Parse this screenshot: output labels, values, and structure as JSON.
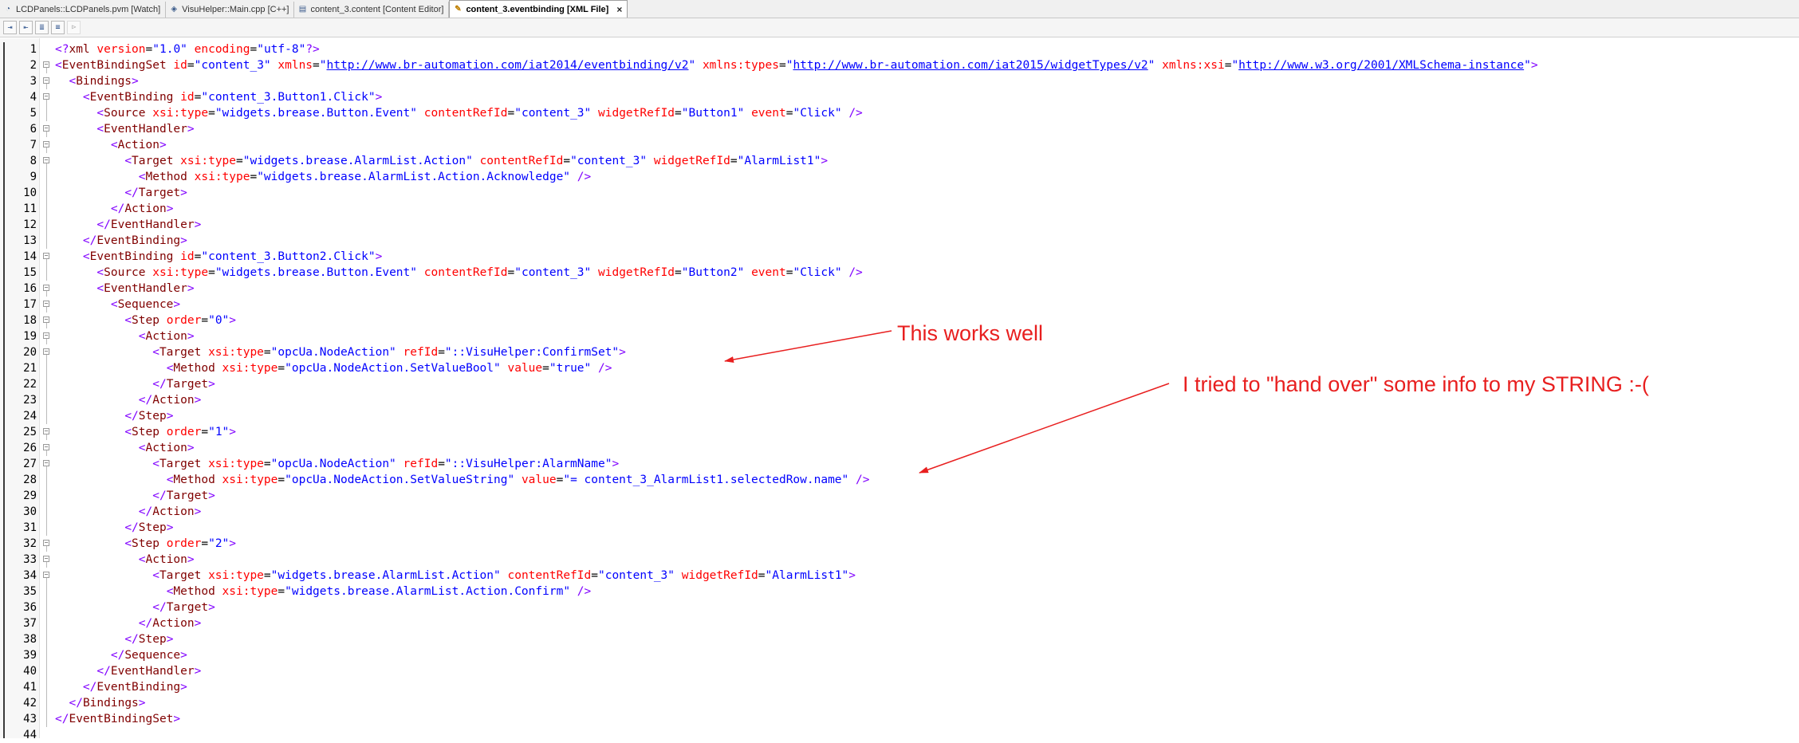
{
  "tabs": [
    {
      "label": "LCDPanels::LCDPanels.pvm [Watch]",
      "icon": "watch-icon",
      "active": false
    },
    {
      "label": "VisuHelper::Main.cpp [C++]",
      "icon": "cpp-file-icon",
      "active": false
    },
    {
      "label": "content_3.content [Content Editor]",
      "icon": "content-file-icon",
      "active": false
    },
    {
      "label": "content_3.eventbinding [XML File]",
      "icon": "xml-file-icon",
      "active": true
    }
  ],
  "active_tab_close": "×",
  "toolbar": [
    {
      "name": "toolbar-button-1",
      "glyph": "⇥"
    },
    {
      "name": "toolbar-button-2",
      "glyph": "⇤"
    },
    {
      "name": "toolbar-button-3",
      "glyph": "≣"
    },
    {
      "name": "toolbar-button-4",
      "glyph": "≡"
    },
    {
      "name": "toolbar-button-5",
      "glyph": "⊳"
    }
  ],
  "colors": {
    "annotation": "#e81f1f",
    "tag": "#800000",
    "attribute": "#ff0000",
    "value": "#0000ff",
    "bracket": "#8000ff"
  },
  "code_lines": [
    [
      [
        "b",
        "<?"
      ],
      [
        "t",
        "xml"
      ],
      [
        "n",
        " "
      ],
      [
        "a",
        "version"
      ],
      [
        "n",
        "="
      ],
      [
        "v",
        "\"1.0\""
      ],
      [
        "n",
        " "
      ],
      [
        "a",
        "encoding"
      ],
      [
        "n",
        "="
      ],
      [
        "v",
        "\"utf-8\""
      ],
      [
        "b",
        "?>"
      ]
    ],
    [
      [
        "b",
        "<"
      ],
      [
        "t",
        "EventBindingSet"
      ],
      [
        "n",
        " "
      ],
      [
        "a",
        "id"
      ],
      [
        "n",
        "="
      ],
      [
        "v",
        "\"content_3\""
      ],
      [
        "n",
        " "
      ],
      [
        "a",
        "xmlns"
      ],
      [
        "n",
        "="
      ],
      [
        "v",
        "\""
      ],
      [
        "l",
        "http://www.br-automation.com/iat2014/eventbinding/v2"
      ],
      [
        "v",
        "\""
      ],
      [
        "n",
        " "
      ],
      [
        "a",
        "xmlns:types"
      ],
      [
        "n",
        "="
      ],
      [
        "v",
        "\""
      ],
      [
        "l",
        "http://www.br-automation.com/iat2015/widgetTypes/v2"
      ],
      [
        "v",
        "\""
      ],
      [
        "n",
        " "
      ],
      [
        "a",
        "xmlns:xsi"
      ],
      [
        "n",
        "="
      ],
      [
        "v",
        "\""
      ],
      [
        "l",
        "http://www.w3.org/2001/XMLSchema-instance"
      ],
      [
        "v",
        "\""
      ],
      [
        "b",
        ">"
      ]
    ],
    [
      [
        "n",
        "  "
      ],
      [
        "b",
        "<"
      ],
      [
        "t",
        "Bindings"
      ],
      [
        "b",
        ">"
      ]
    ],
    [
      [
        "n",
        "    "
      ],
      [
        "b",
        "<"
      ],
      [
        "t",
        "EventBinding"
      ],
      [
        "n",
        " "
      ],
      [
        "a",
        "id"
      ],
      [
        "n",
        "="
      ],
      [
        "v",
        "\"content_3.Button1.Click\""
      ],
      [
        "b",
        ">"
      ]
    ],
    [
      [
        "n",
        "      "
      ],
      [
        "b",
        "<"
      ],
      [
        "t",
        "Source"
      ],
      [
        "n",
        " "
      ],
      [
        "a",
        "xsi:type"
      ],
      [
        "n",
        "="
      ],
      [
        "v",
        "\"widgets.brease.Button.Event\""
      ],
      [
        "n",
        " "
      ],
      [
        "a",
        "contentRefId"
      ],
      [
        "n",
        "="
      ],
      [
        "v",
        "\"content_3\""
      ],
      [
        "n",
        " "
      ],
      [
        "a",
        "widgetRefId"
      ],
      [
        "n",
        "="
      ],
      [
        "v",
        "\"Button1\""
      ],
      [
        "n",
        " "
      ],
      [
        "a",
        "event"
      ],
      [
        "n",
        "="
      ],
      [
        "v",
        "\"Click\""
      ],
      [
        "n",
        " "
      ],
      [
        "b",
        "/>"
      ]
    ],
    [
      [
        "n",
        "      "
      ],
      [
        "b",
        "<"
      ],
      [
        "t",
        "EventHandler"
      ],
      [
        "b",
        ">"
      ]
    ],
    [
      [
        "n",
        "        "
      ],
      [
        "b",
        "<"
      ],
      [
        "t",
        "Action"
      ],
      [
        "b",
        ">"
      ]
    ],
    [
      [
        "n",
        "          "
      ],
      [
        "b",
        "<"
      ],
      [
        "t",
        "Target"
      ],
      [
        "n",
        " "
      ],
      [
        "a",
        "xsi:type"
      ],
      [
        "n",
        "="
      ],
      [
        "v",
        "\"widgets.brease.AlarmList.Action\""
      ],
      [
        "n",
        " "
      ],
      [
        "a",
        "contentRefId"
      ],
      [
        "n",
        "="
      ],
      [
        "v",
        "\"content_3\""
      ],
      [
        "n",
        " "
      ],
      [
        "a",
        "widgetRefId"
      ],
      [
        "n",
        "="
      ],
      [
        "v",
        "\"AlarmList1\""
      ],
      [
        "b",
        ">"
      ]
    ],
    [
      [
        "n",
        "            "
      ],
      [
        "b",
        "<"
      ],
      [
        "t",
        "Method"
      ],
      [
        "n",
        " "
      ],
      [
        "a",
        "xsi:type"
      ],
      [
        "n",
        "="
      ],
      [
        "v",
        "\"widgets.brease.AlarmList.Action.Acknowledge\""
      ],
      [
        "n",
        " "
      ],
      [
        "b",
        "/>"
      ]
    ],
    [
      [
        "n",
        "          "
      ],
      [
        "b",
        "</"
      ],
      [
        "t",
        "Target"
      ],
      [
        "b",
        ">"
      ]
    ],
    [
      [
        "n",
        "        "
      ],
      [
        "b",
        "</"
      ],
      [
        "t",
        "Action"
      ],
      [
        "b",
        ">"
      ]
    ],
    [
      [
        "n",
        "      "
      ],
      [
        "b",
        "</"
      ],
      [
        "t",
        "EventHandler"
      ],
      [
        "b",
        ">"
      ]
    ],
    [
      [
        "n",
        "    "
      ],
      [
        "b",
        "</"
      ],
      [
        "t",
        "EventBinding"
      ],
      [
        "b",
        ">"
      ]
    ],
    [
      [
        "n",
        "    "
      ],
      [
        "b",
        "<"
      ],
      [
        "t",
        "EventBinding"
      ],
      [
        "n",
        " "
      ],
      [
        "a",
        "id"
      ],
      [
        "n",
        "="
      ],
      [
        "v",
        "\"content_3.Button2.Click\""
      ],
      [
        "b",
        ">"
      ]
    ],
    [
      [
        "n",
        "      "
      ],
      [
        "b",
        "<"
      ],
      [
        "t",
        "Source"
      ],
      [
        "n",
        " "
      ],
      [
        "a",
        "xsi:type"
      ],
      [
        "n",
        "="
      ],
      [
        "v",
        "\"widgets.brease.Button.Event\""
      ],
      [
        "n",
        " "
      ],
      [
        "a",
        "contentRefId"
      ],
      [
        "n",
        "="
      ],
      [
        "v",
        "\"content_3\""
      ],
      [
        "n",
        " "
      ],
      [
        "a",
        "widgetRefId"
      ],
      [
        "n",
        "="
      ],
      [
        "v",
        "\"Button2\""
      ],
      [
        "n",
        " "
      ],
      [
        "a",
        "event"
      ],
      [
        "n",
        "="
      ],
      [
        "v",
        "\"Click\""
      ],
      [
        "n",
        " "
      ],
      [
        "b",
        "/>"
      ]
    ],
    [
      [
        "n",
        "      "
      ],
      [
        "b",
        "<"
      ],
      [
        "t",
        "EventHandler"
      ],
      [
        "b",
        ">"
      ]
    ],
    [
      [
        "n",
        "        "
      ],
      [
        "b",
        "<"
      ],
      [
        "t",
        "Sequence"
      ],
      [
        "b",
        ">"
      ]
    ],
    [
      [
        "n",
        "          "
      ],
      [
        "b",
        "<"
      ],
      [
        "t",
        "Step"
      ],
      [
        "n",
        " "
      ],
      [
        "a",
        "order"
      ],
      [
        "n",
        "="
      ],
      [
        "v",
        "\"0\""
      ],
      [
        "b",
        ">"
      ]
    ],
    [
      [
        "n",
        "            "
      ],
      [
        "b",
        "<"
      ],
      [
        "t",
        "Action"
      ],
      [
        "b",
        ">"
      ]
    ],
    [
      [
        "n",
        "              "
      ],
      [
        "b",
        "<"
      ],
      [
        "t",
        "Target"
      ],
      [
        "n",
        " "
      ],
      [
        "a",
        "xsi:type"
      ],
      [
        "n",
        "="
      ],
      [
        "v",
        "\"opcUa.NodeAction\""
      ],
      [
        "n",
        " "
      ],
      [
        "a",
        "refId"
      ],
      [
        "n",
        "="
      ],
      [
        "v",
        "\"::VisuHelper:ConfirmSet\""
      ],
      [
        "b",
        ">"
      ]
    ],
    [
      [
        "n",
        "                "
      ],
      [
        "b",
        "<"
      ],
      [
        "t",
        "Method"
      ],
      [
        "n",
        " "
      ],
      [
        "a",
        "xsi:type"
      ],
      [
        "n",
        "="
      ],
      [
        "v",
        "\"opcUa.NodeAction.SetValueBool\""
      ],
      [
        "n",
        " "
      ],
      [
        "a",
        "value"
      ],
      [
        "n",
        "="
      ],
      [
        "v",
        "\"true\""
      ],
      [
        "n",
        " "
      ],
      [
        "b",
        "/>"
      ]
    ],
    [
      [
        "n",
        "              "
      ],
      [
        "b",
        "</"
      ],
      [
        "t",
        "Target"
      ],
      [
        "b",
        ">"
      ]
    ],
    [
      [
        "n",
        "            "
      ],
      [
        "b",
        "</"
      ],
      [
        "t",
        "Action"
      ],
      [
        "b",
        ">"
      ]
    ],
    [
      [
        "n",
        "          "
      ],
      [
        "b",
        "</"
      ],
      [
        "t",
        "Step"
      ],
      [
        "b",
        ">"
      ]
    ],
    [
      [
        "n",
        "          "
      ],
      [
        "b",
        "<"
      ],
      [
        "t",
        "Step"
      ],
      [
        "n",
        " "
      ],
      [
        "a",
        "order"
      ],
      [
        "n",
        "="
      ],
      [
        "v",
        "\"1\""
      ],
      [
        "b",
        ">"
      ]
    ],
    [
      [
        "n",
        "            "
      ],
      [
        "b",
        "<"
      ],
      [
        "t",
        "Action"
      ],
      [
        "b",
        ">"
      ]
    ],
    [
      [
        "n",
        "              "
      ],
      [
        "b",
        "<"
      ],
      [
        "t",
        "Target"
      ],
      [
        "n",
        " "
      ],
      [
        "a",
        "xsi:type"
      ],
      [
        "n",
        "="
      ],
      [
        "v",
        "\"opcUa.NodeAction\""
      ],
      [
        "n",
        " "
      ],
      [
        "a",
        "refId"
      ],
      [
        "n",
        "="
      ],
      [
        "v",
        "\"::VisuHelper:AlarmName\""
      ],
      [
        "b",
        ">"
      ]
    ],
    [
      [
        "n",
        "                "
      ],
      [
        "b",
        "<"
      ],
      [
        "t",
        "Method"
      ],
      [
        "n",
        " "
      ],
      [
        "a",
        "xsi:type"
      ],
      [
        "n",
        "="
      ],
      [
        "v",
        "\"opcUa.NodeAction.SetValueString\""
      ],
      [
        "n",
        " "
      ],
      [
        "a",
        "value"
      ],
      [
        "n",
        "="
      ],
      [
        "v",
        "\"= content_3_AlarmList1.selectedRow.name\""
      ],
      [
        "n",
        " "
      ],
      [
        "b",
        "/>"
      ]
    ],
    [
      [
        "n",
        "              "
      ],
      [
        "b",
        "</"
      ],
      [
        "t",
        "Target"
      ],
      [
        "b",
        ">"
      ]
    ],
    [
      [
        "n",
        "            "
      ],
      [
        "b",
        "</"
      ],
      [
        "t",
        "Action"
      ],
      [
        "b",
        ">"
      ]
    ],
    [
      [
        "n",
        "          "
      ],
      [
        "b",
        "</"
      ],
      [
        "t",
        "Step"
      ],
      [
        "b",
        ">"
      ]
    ],
    [
      [
        "n",
        "          "
      ],
      [
        "b",
        "<"
      ],
      [
        "t",
        "Step"
      ],
      [
        "n",
        " "
      ],
      [
        "a",
        "order"
      ],
      [
        "n",
        "="
      ],
      [
        "v",
        "\"2\""
      ],
      [
        "b",
        ">"
      ]
    ],
    [
      [
        "n",
        "            "
      ],
      [
        "b",
        "<"
      ],
      [
        "t",
        "Action"
      ],
      [
        "b",
        ">"
      ]
    ],
    [
      [
        "n",
        "              "
      ],
      [
        "b",
        "<"
      ],
      [
        "t",
        "Target"
      ],
      [
        "n",
        " "
      ],
      [
        "a",
        "xsi:type"
      ],
      [
        "n",
        "="
      ],
      [
        "v",
        "\"widgets.brease.AlarmList.Action\""
      ],
      [
        "n",
        " "
      ],
      [
        "a",
        "contentRefId"
      ],
      [
        "n",
        "="
      ],
      [
        "v",
        "\"content_3\""
      ],
      [
        "n",
        " "
      ],
      [
        "a",
        "widgetRefId"
      ],
      [
        "n",
        "="
      ],
      [
        "v",
        "\"AlarmList1\""
      ],
      [
        "b",
        ">"
      ]
    ],
    [
      [
        "n",
        "                "
      ],
      [
        "b",
        "<"
      ],
      [
        "t",
        "Method"
      ],
      [
        "n",
        " "
      ],
      [
        "a",
        "xsi:type"
      ],
      [
        "n",
        "="
      ],
      [
        "v",
        "\"widgets.brease.AlarmList.Action.Confirm\""
      ],
      [
        "n",
        " "
      ],
      [
        "b",
        "/>"
      ]
    ],
    [
      [
        "n",
        "              "
      ],
      [
        "b",
        "</"
      ],
      [
        "t",
        "Target"
      ],
      [
        "b",
        ">"
      ]
    ],
    [
      [
        "n",
        "            "
      ],
      [
        "b",
        "</"
      ],
      [
        "t",
        "Action"
      ],
      [
        "b",
        ">"
      ]
    ],
    [
      [
        "n",
        "          "
      ],
      [
        "b",
        "</"
      ],
      [
        "t",
        "Step"
      ],
      [
        "b",
        ">"
      ]
    ],
    [
      [
        "n",
        "        "
      ],
      [
        "b",
        "</"
      ],
      [
        "t",
        "Sequence"
      ],
      [
        "b",
        ">"
      ]
    ],
    [
      [
        "n",
        "      "
      ],
      [
        "b",
        "</"
      ],
      [
        "t",
        "EventHandler"
      ],
      [
        "b",
        ">"
      ]
    ],
    [
      [
        "n",
        "    "
      ],
      [
        "b",
        "</"
      ],
      [
        "t",
        "EventBinding"
      ],
      [
        "b",
        ">"
      ]
    ],
    [
      [
        "n",
        "  "
      ],
      [
        "b",
        "</"
      ],
      [
        "t",
        "Bindings"
      ],
      [
        "b",
        ">"
      ]
    ],
    [
      [
        "b",
        "</"
      ],
      [
        "t",
        "EventBindingSet"
      ],
      [
        "b",
        ">"
      ]
    ],
    []
  ],
  "fold_markers": [
    2,
    3,
    4,
    6,
    7,
    8,
    14,
    16,
    17,
    18,
    19,
    20,
    25,
    26,
    27,
    32,
    33,
    34
  ],
  "annotations": [
    {
      "text": "This works well"
    },
    {
      "text": "I tried to \"hand over\" some info to my STRING :-("
    }
  ]
}
